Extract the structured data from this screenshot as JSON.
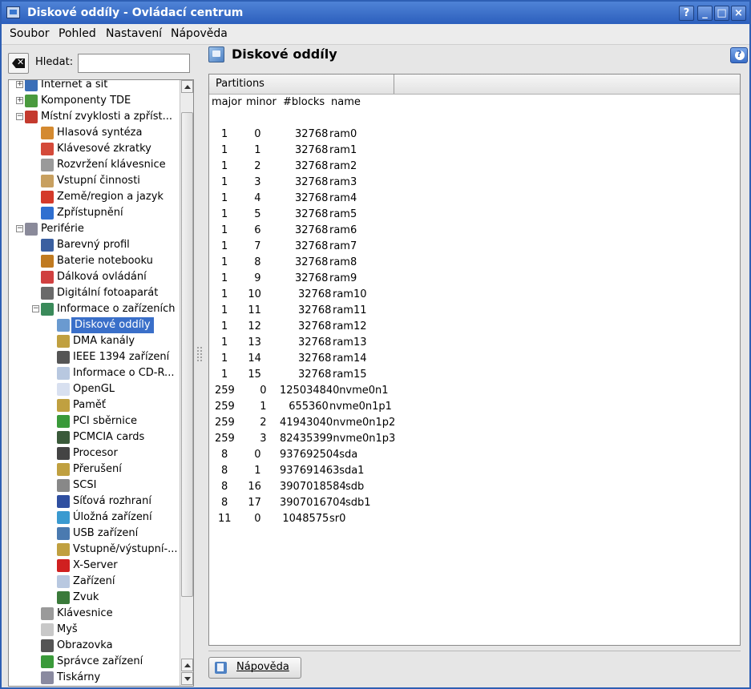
{
  "window": {
    "title": "Diskové oddíly - Ovládací centrum",
    "buttons": [
      "?",
      "_",
      "□",
      "×"
    ]
  },
  "menu": [
    "Soubor",
    "Pohled",
    "Nastavení",
    "Nápověda"
  ],
  "search": {
    "label": "Hledat:",
    "value": ""
  },
  "tree": [
    {
      "label": "Internet a síť",
      "level": 0,
      "expander": "+",
      "icon": "globe-icon",
      "color": "#3b6fb8"
    },
    {
      "label": "Komponenty TDE",
      "level": 0,
      "expander": "+",
      "icon": "components-icon",
      "color": "#4a9a3e"
    },
    {
      "label": "Místní zvyklosti a zpříst...",
      "level": 0,
      "expander": "-",
      "icon": "locale-icon",
      "color": "#c43a2e"
    },
    {
      "label": "Hlasová syntéza",
      "level": 1,
      "icon": "speech-icon",
      "color": "#d48a30"
    },
    {
      "label": "Klávesové zkratky",
      "level": 1,
      "icon": "shortcuts-icon",
      "color": "#d44a3a"
    },
    {
      "label": "Rozvržení klávesnice",
      "level": 1,
      "icon": "keyboard-layout-icon",
      "color": "#9a9a9a"
    },
    {
      "label": "Vstupní činnosti",
      "level": 1,
      "icon": "input-actions-icon",
      "color": "#c8a060"
    },
    {
      "label": "Země/region a jazyk",
      "level": 1,
      "icon": "flag-icon",
      "color": "#d43a2a"
    },
    {
      "label": "Zpřístupnění",
      "level": 1,
      "icon": "accessibility-icon",
      "color": "#2f6fd0"
    },
    {
      "label": "Periférie",
      "level": 0,
      "expander": "-",
      "icon": "mouse-peripheral-icon",
      "color": "#8a8a9a"
    },
    {
      "label": "Barevný profil",
      "level": 1,
      "icon": "color-profile-icon",
      "color": "#3a5fa0"
    },
    {
      "label": "Baterie notebooku",
      "level": 1,
      "icon": "battery-icon",
      "color": "#c07a20"
    },
    {
      "label": "Dálková ovládání",
      "level": 1,
      "icon": "remote-icon",
      "color": "#d04040"
    },
    {
      "label": "Digitální fotoaparát",
      "level": 1,
      "icon": "camera-icon",
      "color": "#6a6a6a"
    },
    {
      "label": "Informace o zařízeních",
      "level": 1,
      "expander": "-",
      "icon": "device-info-icon",
      "color": "#3a8a5a"
    },
    {
      "label": "Diskové oddíly",
      "level": 2,
      "icon": "partitions-icon",
      "color": "#6a9ad0",
      "selected": true
    },
    {
      "label": "DMA kanály",
      "level": 2,
      "icon": "dma-icon",
      "color": "#c0a040"
    },
    {
      "label": "IEEE 1394 zařízení",
      "level": 2,
      "icon": "ieee1394-icon",
      "color": "#555555"
    },
    {
      "label": "Informace o CD-R...",
      "level": 2,
      "icon": "cdrom-icon",
      "color": "#b8c8e0"
    },
    {
      "label": "OpenGL",
      "level": 2,
      "icon": "opengl-icon",
      "color": "#d8e0f0"
    },
    {
      "label": "Paměť",
      "level": 2,
      "icon": "memory-icon",
      "color": "#c0a040"
    },
    {
      "label": "PCI sběrnice",
      "level": 2,
      "icon": "pci-icon",
      "color": "#3a9a3a"
    },
    {
      "label": "PCMCIA cards",
      "level": 2,
      "icon": "pcmcia-icon",
      "color": "#3a5a3a"
    },
    {
      "label": "Procesor",
      "level": 2,
      "icon": "cpu-icon",
      "color": "#444444"
    },
    {
      "label": "Přerušení",
      "level": 2,
      "icon": "interrupts-icon",
      "color": "#c0a040"
    },
    {
      "label": "SCSI",
      "level": 2,
      "icon": "scsi-icon",
      "color": "#888888"
    },
    {
      "label": "Síťová rozhraní",
      "level": 2,
      "icon": "network-icon",
      "color": "#2f4fa0"
    },
    {
      "label": "Úložná zařízení",
      "level": 2,
      "icon": "storage-icon",
      "color": "#3a9ad0"
    },
    {
      "label": "USB zařízení",
      "level": 2,
      "icon": "usb-icon",
      "color": "#4a7ab0"
    },
    {
      "label": "Vstupně/výstupní-...",
      "level": 2,
      "icon": "io-ports-icon",
      "color": "#c0a040"
    },
    {
      "label": "X-Server",
      "level": 2,
      "icon": "xserver-icon",
      "color": "#d02020"
    },
    {
      "label": "Zařízení",
      "level": 2,
      "icon": "devices-icon",
      "color": "#b8c8e0"
    },
    {
      "label": "Zvuk",
      "level": 2,
      "icon": "sound-icon",
      "color": "#3a7a3a"
    },
    {
      "label": "Klávesnice",
      "level": 1,
      "icon": "keyboard-icon",
      "color": "#9a9a9a"
    },
    {
      "label": "Myš",
      "level": 1,
      "icon": "mouse-icon",
      "color": "#c8c8c8"
    },
    {
      "label": "Obrazovka",
      "level": 1,
      "icon": "display-icon",
      "color": "#555555"
    },
    {
      "label": "Správce zařízení",
      "level": 1,
      "icon": "device-manager-icon",
      "color": "#3a9a3a"
    },
    {
      "label": "Tiskárny",
      "level": 1,
      "icon": "printer-icon",
      "color": "#8a8aa0"
    }
  ],
  "module": {
    "title": "Diskové oddíly",
    "help_mark": "?"
  },
  "content": {
    "column_header": "Partitions",
    "table_header": [
      "major",
      "minor",
      "#blocks",
      "name"
    ],
    "rows": [
      [
        "1",
        "0",
        "32768",
        "ram0"
      ],
      [
        "1",
        "1",
        "32768",
        "ram1"
      ],
      [
        "1",
        "2",
        "32768",
        "ram2"
      ],
      [
        "1",
        "3",
        "32768",
        "ram3"
      ],
      [
        "1",
        "4",
        "32768",
        "ram4"
      ],
      [
        "1",
        "5",
        "32768",
        "ram5"
      ],
      [
        "1",
        "6",
        "32768",
        "ram6"
      ],
      [
        "1",
        "7",
        "32768",
        "ram7"
      ],
      [
        "1",
        "8",
        "32768",
        "ram8"
      ],
      [
        "1",
        "9",
        "32768",
        "ram9"
      ],
      [
        "1",
        "10",
        "32768",
        "ram10"
      ],
      [
        "1",
        "11",
        "32768",
        "ram11"
      ],
      [
        "1",
        "12",
        "32768",
        "ram12"
      ],
      [
        "1",
        "13",
        "32768",
        "ram13"
      ],
      [
        "1",
        "14",
        "32768",
        "ram14"
      ],
      [
        "1",
        "15",
        "32768",
        "ram15"
      ],
      [
        "259",
        "0",
        "125034840",
        "nvme0n1"
      ],
      [
        "259",
        "1",
        "655360",
        "nvme0n1p1"
      ],
      [
        "259",
        "2",
        "41943040",
        "nvme0n1p2"
      ],
      [
        "259",
        "3",
        "82435399",
        "nvme0n1p3"
      ],
      [
        "8",
        "0",
        "937692504",
        "sda"
      ],
      [
        "8",
        "1",
        "937691463",
        "sda1"
      ],
      [
        "8",
        "16",
        "3907018584",
        "sdb"
      ],
      [
        "8",
        "17",
        "3907016704",
        "sdb1"
      ],
      [
        "11",
        "0",
        "1048575",
        "sr0"
      ]
    ]
  },
  "footer": {
    "help_button": "Nápověda"
  }
}
